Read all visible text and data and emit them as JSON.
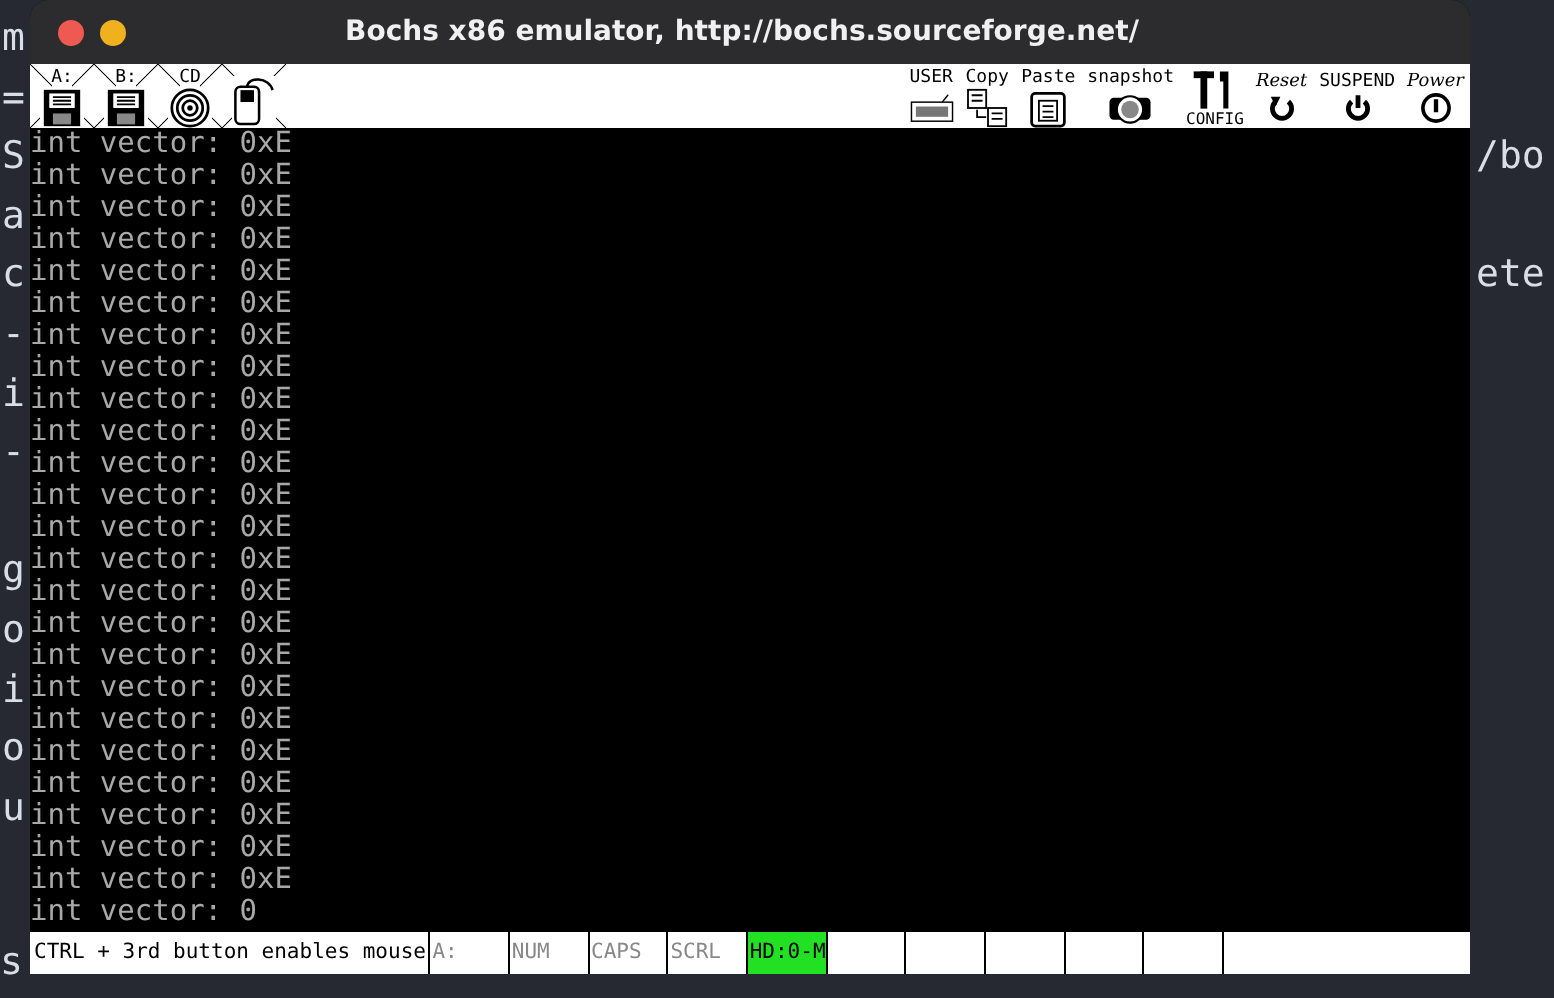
{
  "background_editor": {
    "lines": [
      {
        "left": "m"
      },
      {
        "left": "="
      },
      {
        "left": "S",
        "right": "/bo"
      },
      {
        "left": "a"
      },
      {
        "left": "c",
        "right": "ete"
      },
      {
        "left": "-"
      },
      {
        "left": "i"
      },
      {
        "left": "-"
      }
    ],
    "lines_lower": [
      {
        "left": "g"
      },
      {
        "left": "o"
      },
      {
        "left": "i"
      },
      {
        "left": "o"
      },
      {
        "left": "u"
      }
    ],
    "bottom_fragment": "s"
  },
  "window": {
    "title": "Bochs x86 emulator, http://bochs.sourceforge.net/"
  },
  "toolbar_left": [
    {
      "kind": "floppy",
      "label": "A:"
    },
    {
      "kind": "floppy",
      "label": "B:"
    },
    {
      "kind": "cdrom",
      "label": "CD"
    },
    {
      "kind": "mouse"
    }
  ],
  "toolbar_right": [
    {
      "kind": "keyboard",
      "label": "USER"
    },
    {
      "kind": "copy",
      "label": "Copy"
    },
    {
      "kind": "paste",
      "label": "Paste"
    },
    {
      "kind": "snapshot",
      "label": "snapshot"
    },
    {
      "kind": "config",
      "label": "CONFIG"
    },
    {
      "kind": "reset",
      "label": "Reset"
    },
    {
      "kind": "suspend",
      "label": "SUSPEND"
    },
    {
      "kind": "power",
      "label": "Power"
    }
  ],
  "console_lines": [
    "int vector: 0xE",
    "int vector: 0xE",
    "int vector: 0xE",
    "int vector: 0xE",
    "int vector: 0xE",
    "int vector: 0xE",
    "int vector: 0xE",
    "int vector: 0xE",
    "int vector: 0xE",
    "int vector: 0xE",
    "int vector: 0xE",
    "int vector: 0xE",
    "int vector: 0xE",
    "int vector: 0xE",
    "int vector: 0xE",
    "int vector: 0xE",
    "int vector: 0xE",
    "int vector: 0xE",
    "int vector: 0xE",
    "int vector: 0xE",
    "int vector: 0xE",
    "int vector: 0xE",
    "int vector: 0xE",
    "int vector: 0xE",
    "int vector: 0"
  ],
  "status_bar": {
    "message": "CTRL + 3rd button enables mouse",
    "indicators": [
      {
        "label": "A:",
        "on": false
      },
      {
        "label": "NUM",
        "on": false
      },
      {
        "label": "CAPS",
        "on": false
      },
      {
        "label": "SCRL",
        "on": false
      },
      {
        "label": "HD:0-M",
        "on": true
      }
    ]
  }
}
